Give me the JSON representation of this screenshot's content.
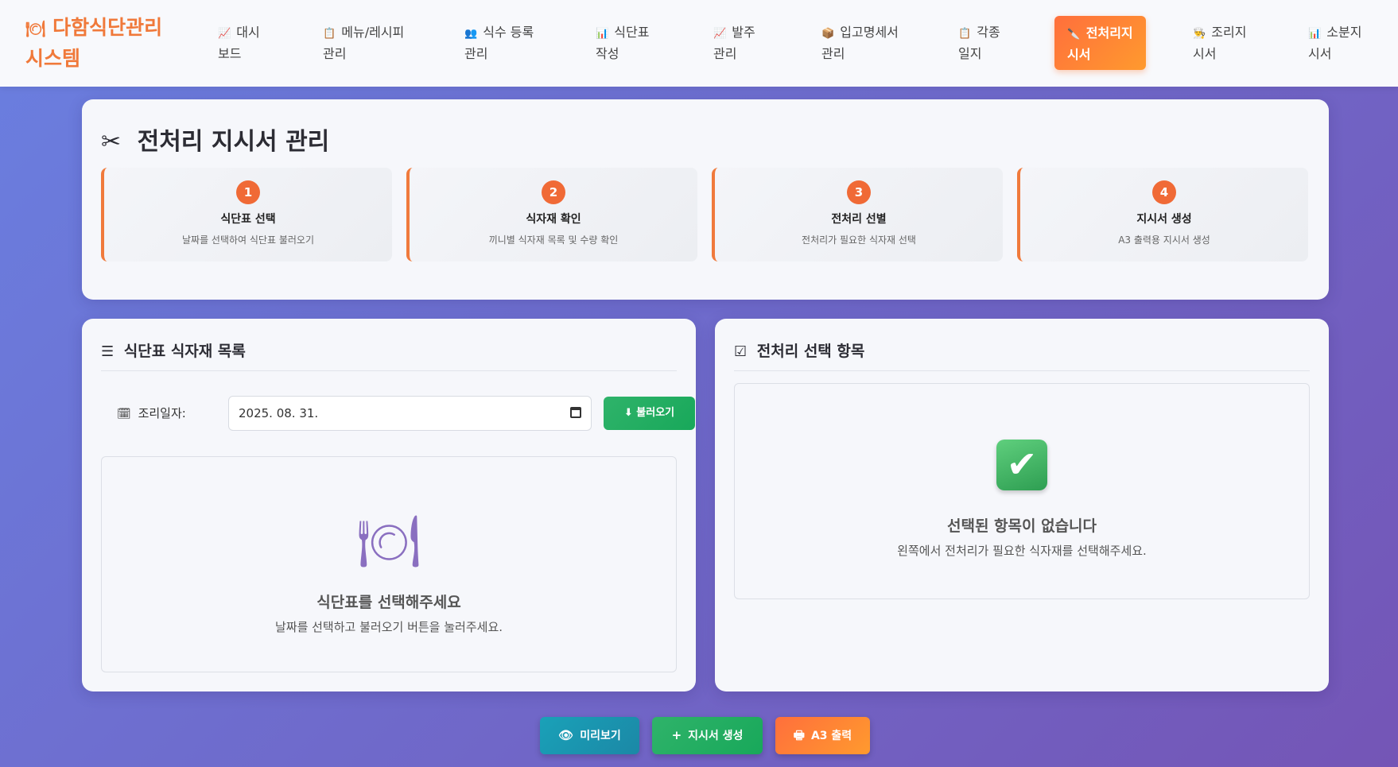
{
  "app": {
    "brand_icon": "🍽",
    "brand_line1": "다함식단관리",
    "brand_line2": "시스템"
  },
  "nav": {
    "items": [
      {
        "icon": "📈",
        "line1": "대시",
        "line2": "보드"
      },
      {
        "icon": "📋",
        "line1": "메뉴/레시피",
        "line2": "관리"
      },
      {
        "icon": "👥",
        "line1": "식수 등록",
        "line2": "관리"
      },
      {
        "icon": "📊",
        "line1": "식단표",
        "line2": "작성"
      },
      {
        "icon": "📈",
        "line1": "발주",
        "line2": "관리"
      },
      {
        "icon": "📦",
        "line1": "입고명세서",
        "line2": "관리"
      },
      {
        "icon": "📋",
        "line1": "각종",
        "line2": "일지"
      },
      {
        "icon": "🔪",
        "line1": "전처리지",
        "line2": "시서"
      },
      {
        "icon": "👨‍🍳",
        "line1": "조리지",
        "line2": "시서"
      },
      {
        "icon": "📊",
        "line1": "소분지",
        "line2": "시서"
      }
    ],
    "active_index": 7
  },
  "page": {
    "title_icon": "✂",
    "title": "전처리 지시서 관리"
  },
  "steps": [
    {
      "num": "1",
      "title": "식단표 선택",
      "desc": "날짜를 선택하여 식단표 불러오기"
    },
    {
      "num": "2",
      "title": "식자재 확인",
      "desc": "끼니별 식자재 목록 및 수량 확인"
    },
    {
      "num": "3",
      "title": "전처리 선별",
      "desc": "전처리가 필요한 식자재 선택"
    },
    {
      "num": "4",
      "title": "지시서 생성",
      "desc": "A3 출력용 지시서 생성"
    }
  ],
  "left_panel": {
    "icon": "☰",
    "title": "식단표 식자재 목록",
    "date_icon": "🗓",
    "date_label": "조리일자:",
    "date_value": "2025. 08. 31.",
    "load_button": "⬇ 불러오기",
    "empty_icon": "🍽",
    "empty_title": "식단표를 선택해주세요",
    "empty_desc": "날짜를 선택하고 불러오기 버튼을 눌러주세요."
  },
  "right_panel": {
    "icon": "☑",
    "title": "전처리 선택 항목",
    "empty_icon": "✔",
    "empty_title": "선택된 항목이 없습니다",
    "empty_desc": "왼쪽에서 전처리가 필요한 식자재를 선택해주세요."
  },
  "actions": {
    "preview": {
      "icon": "👁",
      "label": "미리보기"
    },
    "generate": {
      "icon": "+",
      "label": "지시서 생성"
    },
    "print": {
      "icon": "🖶",
      "label": "A3 출력"
    }
  },
  "colors": {
    "brand": "#f0793a",
    "accent_orange": "#ff6f3c",
    "green": "#18a85a",
    "teal": "#1b88a6"
  }
}
